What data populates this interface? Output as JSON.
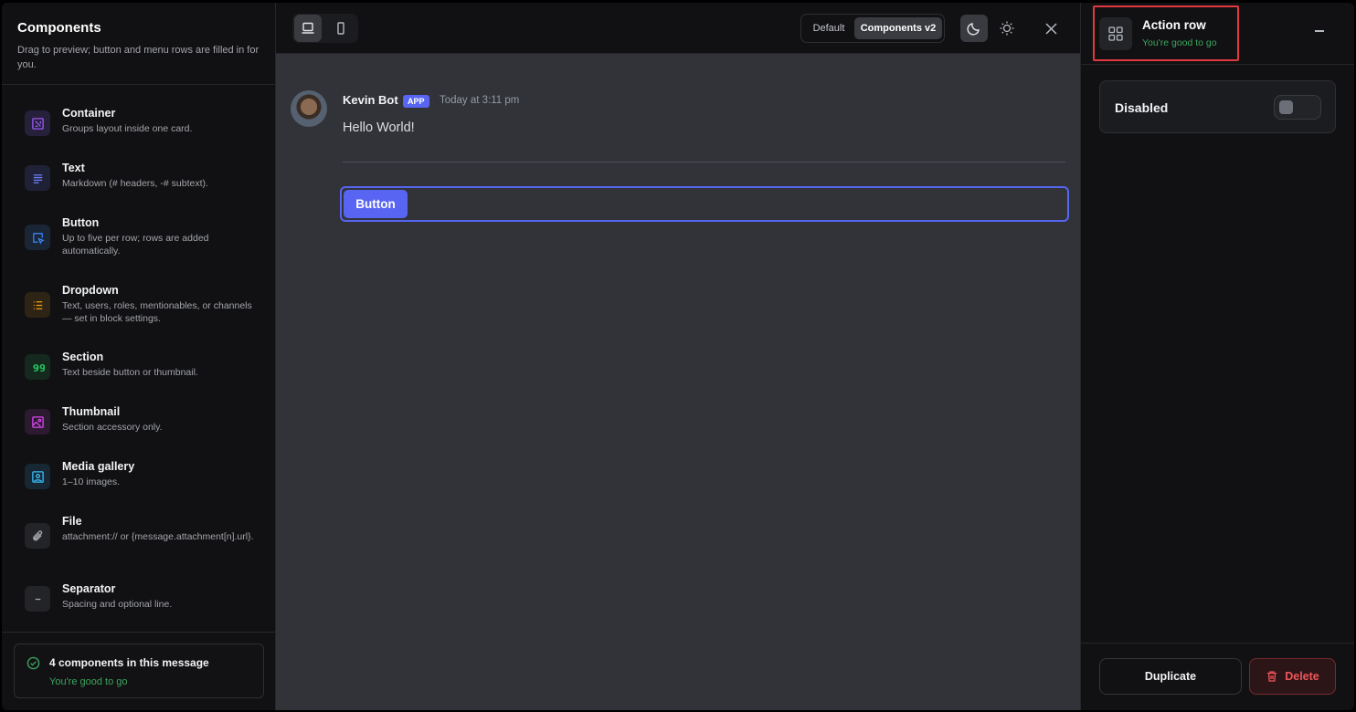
{
  "sidebar": {
    "title": "Components",
    "subtitle": "Drag to preview; button and menu rows are filled in for you.",
    "items": [
      {
        "name": "Container",
        "desc": "Groups layout inside one card.",
        "icon": "container-icon",
        "color": "#9b59f5",
        "bg": "#26203a"
      },
      {
        "name": "Text",
        "desc": "Markdown (# headers, -# subtext).",
        "icon": "text-lines-icon",
        "color": "#6c7cf5",
        "bg": "#1f2236"
      },
      {
        "name": "Button",
        "desc": "Up to five per row; rows are added automatically.",
        "icon": "button-cursor-icon",
        "color": "#3b82f6",
        "bg": "#1a2536"
      },
      {
        "name": "Dropdown",
        "desc": "Text, users, roles, mentionables, or channels — set in block settings.",
        "icon": "list-icon",
        "color": "#f59e0b",
        "bg": "#2e2416"
      },
      {
        "name": "Section",
        "desc": "Text beside button or thumbnail.",
        "icon": "quote-icon",
        "color": "#22c55e",
        "bg": "#16291e"
      },
      {
        "name": "Thumbnail",
        "desc": "Section accessory only.",
        "icon": "image-icon",
        "color": "#d946ef",
        "bg": "#2c1a30"
      },
      {
        "name": "Media gallery",
        "desc": "1–10 images.",
        "icon": "gallery-icon",
        "color": "#38bdf8",
        "bg": "#172733"
      },
      {
        "name": "File",
        "desc": "attachment:// or {message.attachment[n].url}.",
        "icon": "paperclip-icon",
        "color": "#a3a5ab",
        "bg": "#232428"
      },
      {
        "name": "Separator",
        "desc": "Spacing and optional line.",
        "icon": "minus-icon",
        "color": "#a3a5ab",
        "bg": "#232428"
      }
    ],
    "summary": {
      "title": "4 components in this message",
      "status": "You're good to go"
    }
  },
  "toolbar": {
    "mode_default": "Default",
    "mode_v2": "Components v2"
  },
  "message": {
    "author": "Kevin Bot",
    "tag": "APP",
    "timestamp": "Today at 3:11 pm",
    "body": "Hello World!",
    "button_label": "Button"
  },
  "panel": {
    "title": "Action row",
    "status": "You're good to go",
    "setting_label": "Disabled",
    "duplicate_label": "Duplicate",
    "delete_label": "Delete"
  }
}
